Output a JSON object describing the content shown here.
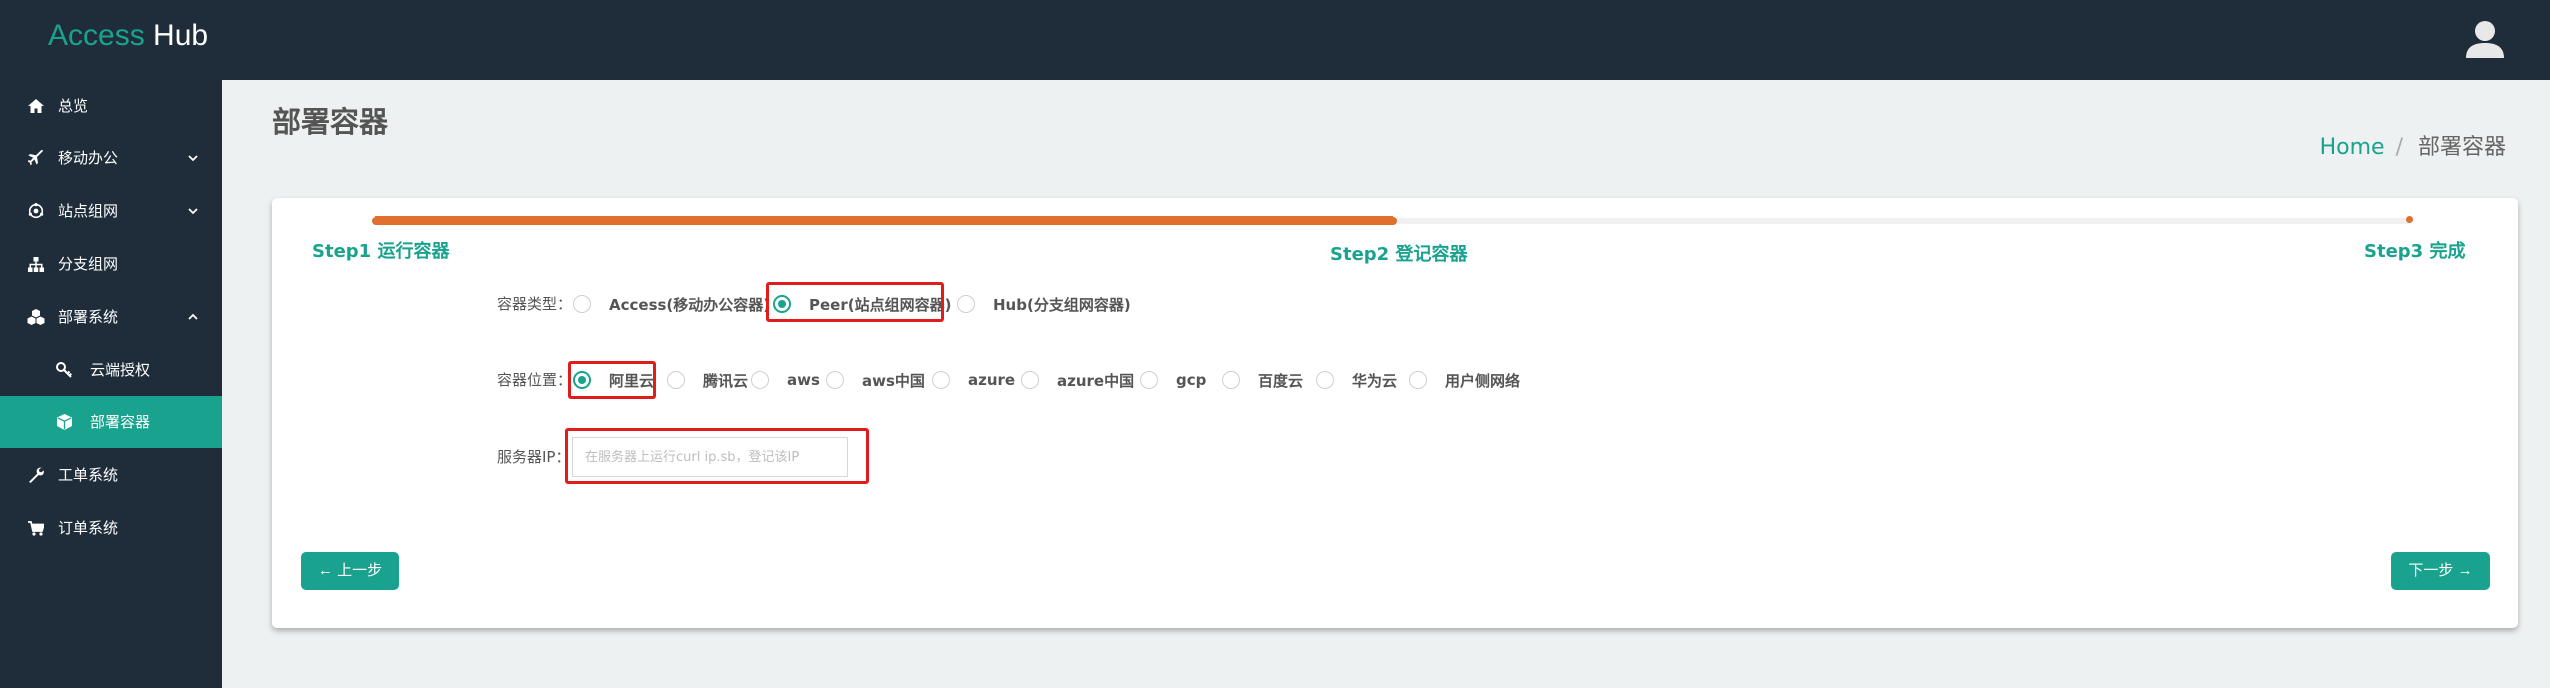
{
  "app": {
    "brand_part1": "Access",
    "brand_part2": "Hub"
  },
  "sidebar": {
    "items": [
      {
        "label": "总览",
        "icon": "home-icon"
      },
      {
        "label": "移动办公",
        "icon": "plane-icon",
        "expandable": true
      },
      {
        "label": "站点组网",
        "icon": "network-icon",
        "expandable": true
      },
      {
        "label": "分支组网",
        "icon": "sitemap-icon"
      },
      {
        "label": "部署系统",
        "icon": "cubes-icon",
        "expanded": true
      },
      {
        "label": "云端授权",
        "icon": "key-icon"
      },
      {
        "label": "部署容器",
        "icon": "cube-icon",
        "active": true
      },
      {
        "label": "工单系统",
        "icon": "wrench-icon"
      },
      {
        "label": "订单系统",
        "icon": "cart-icon"
      }
    ]
  },
  "page": {
    "title": "部署容器"
  },
  "breadcrumb": {
    "home": "Home",
    "separator": "/",
    "current": "部署容器"
  },
  "steps": {
    "step1": "Step1 运行容器",
    "step2": "Step2 登记容器",
    "step3": "Step3 完成",
    "current": 2
  },
  "form": {
    "container_type": {
      "label": "容器类型：",
      "options": [
        "Access(移动办公容器)",
        "Peer(站点组网容器)",
        "Hub(分支组网容器)"
      ],
      "selected": "Peer(站点组网容器)"
    },
    "container_location": {
      "label": "容器位置：",
      "options": [
        "阿里云",
        "腾讯云",
        "aws",
        "aws中国",
        "azure",
        "azure中国",
        "gcp",
        "百度云",
        "华为云",
        "用户侧网络"
      ],
      "selected": "阿里云"
    },
    "server_ip": {
      "label": "服务器IP：",
      "value": "",
      "placeholder": "在服务器上运行curl ip.sb，登记该IP"
    }
  },
  "buttons": {
    "prev": "← 上一步",
    "next": "下一步 →"
  },
  "colors": {
    "accent": "#19a38f",
    "sidebar_bg": "#1f2d3a",
    "progress": "#e0702e",
    "highlight": "#e01c1c"
  }
}
